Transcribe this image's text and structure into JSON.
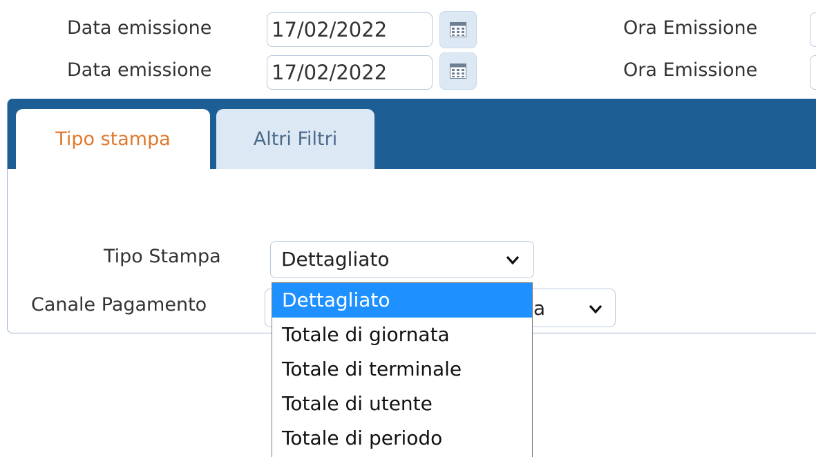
{
  "top_fields": {
    "row1": {
      "date_label": "Data emissione",
      "date_value": "17/02/2022",
      "time_label": "Ora Emissione"
    },
    "row2": {
      "date_label": "Data emissione",
      "date_value": "17/02/2022",
      "time_label": "Ora Emissione"
    }
  },
  "tabs": [
    {
      "label": "Tipo stampa",
      "active": true
    },
    {
      "label": "Altri Filtri",
      "active": false
    }
  ],
  "form": {
    "tipo_stampa_label": "Tipo Stampa",
    "tipo_stampa_value": "Dettagliato",
    "canale_label": "Canale Pagamento",
    "canale_value_fragment": "a"
  },
  "dropdown": {
    "options": [
      "Dettagliato",
      "Totale di giornata",
      "Totale di terminale",
      "Totale di utente",
      "Totale di periodo"
    ],
    "selected_index": 0
  },
  "colors": {
    "tab_bar": "#1d5e95",
    "active_tab_text": "#e0782b",
    "selected_option": "#1e90ff"
  },
  "icons": {
    "calendar": "calendar-icon",
    "chevron": "chevron-down-icon"
  }
}
